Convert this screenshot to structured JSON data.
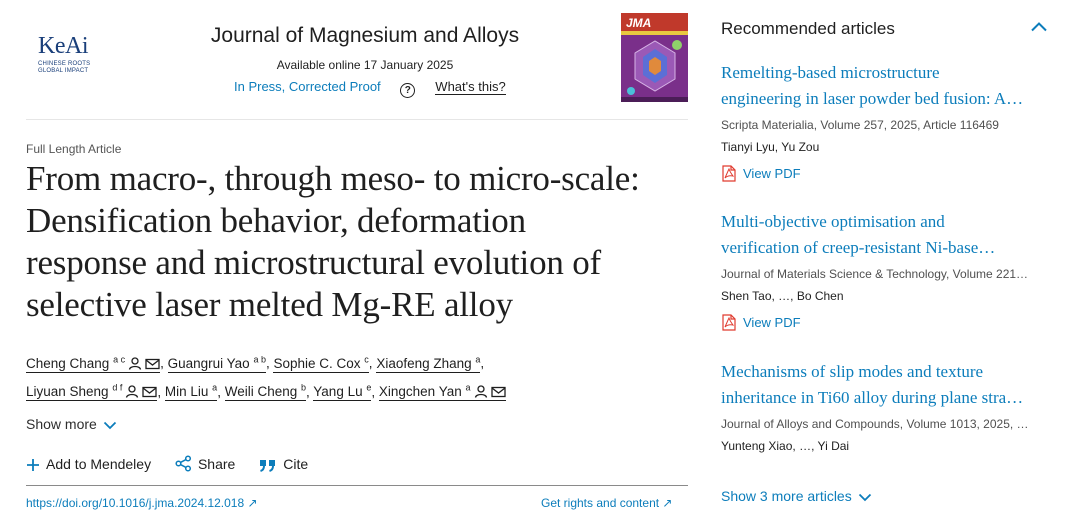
{
  "publisher": {
    "logo_word": "KeAi",
    "tagline_1": "CHINESE ROOTS",
    "tagline_2": "GLOBAL IMPACT"
  },
  "journal": {
    "title": "Journal of Magnesium and Alloys",
    "available": "Available online 17 January 2025",
    "status": "In Press, Corrected Proof",
    "whats_this": "What's this?",
    "cover_label": "JMA"
  },
  "article": {
    "type": "Full Length Article",
    "title_lines": [
      "From macro-, through meso- to micro-scale:",
      "Densification behavior, deformation",
      "response and microstructural evolution of",
      "selective laser melted Mg-RE alloy"
    ],
    "authors": [
      {
        "name": "Cheng Chang",
        "aff": "a c"
      },
      {
        "name": "Guangrui Yao",
        "aff": "a b"
      },
      {
        "name": "Sophie C. Cox",
        "aff": "c"
      },
      {
        "name": "Xiaofeng Zhang",
        "aff": "a"
      },
      {
        "name": "Liyuan Sheng",
        "aff": "d f"
      },
      {
        "name": "Min Liu",
        "aff": "a"
      },
      {
        "name": "Weili Cheng",
        "aff": "b"
      },
      {
        "name": "Yang Lu",
        "aff": "e"
      },
      {
        "name": "Xingchen Yan",
        "aff": "a"
      }
    ],
    "show_more": "Show more",
    "actions": {
      "mendeley": "Add to Mendeley",
      "share": "Share",
      "cite": "Cite"
    },
    "doi": "https://doi.org/10.1016/j.jma.2024.12.018",
    "rights": "Get rights and content"
  },
  "recommended": {
    "title": "Recommended articles",
    "items": [
      {
        "title": "Remelting-based microstructure",
        "title2": "engineering in laser powder bed fusion: A…",
        "source": "Scripta Materialia, Volume 257, 2025, Article 116469",
        "authors": "Tianyi Lyu, Yu Zou",
        "pdf": "View PDF"
      },
      {
        "title": "Multi-objective optimisation and",
        "title2": "verification of creep-resistant Ni-base…",
        "source": "Journal of Materials Science & Technology, Volume 221…",
        "authors": "Shen Tao, …, Bo Chen",
        "pdf": "View PDF"
      },
      {
        "title": "Mechanisms of slip modes and texture",
        "title2": "inheritance in Ti60 alloy during plane stra…",
        "source": "Journal of Alloys and Compounds, Volume 1013, 2025, …",
        "authors": "Yunteng Xiao, …, Yi Dai"
      }
    ],
    "show_more": "Show 3 more articles"
  },
  "colors": {
    "link": "#0c7dbb",
    "logo": "#1a3f7a",
    "pdf_icon": "#e03b2f"
  }
}
